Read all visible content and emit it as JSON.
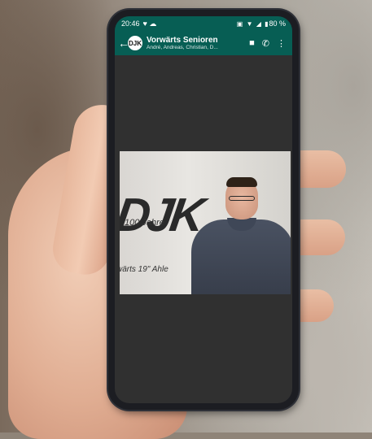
{
  "status_bar": {
    "time": "20:46",
    "left_icons": "♥ ☁",
    "system_icons": "▣ ▼ ◢ ▮",
    "battery": "80 %"
  },
  "chat": {
    "avatar_text": "DJK",
    "title": "Vorwärts Senioren",
    "subtitle": "André, Andreas, Christian, D..."
  },
  "video_overlay": {
    "logo": "DJK",
    "anniversary": "100 Jahre",
    "club": "wärts 19\" Ahle"
  },
  "icons": {
    "back": "arrow-left",
    "video_call": "video-camera",
    "voice_call": "phone",
    "menu": "more-vertical"
  },
  "colors": {
    "header": "#075e54",
    "chat_background": "#303030"
  }
}
